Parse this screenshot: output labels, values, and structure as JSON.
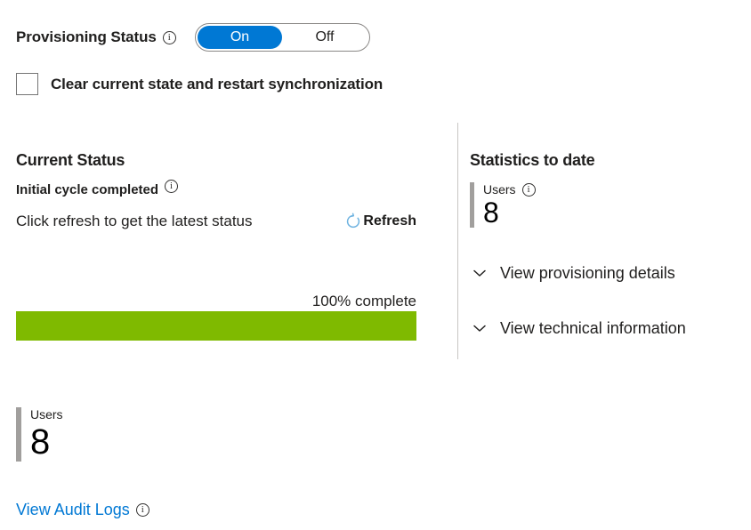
{
  "provisioning": {
    "label": "Provisioning Status",
    "info_icon": "info-icon",
    "toggle": {
      "on_label": "On",
      "off_label": "Off",
      "selected": "On"
    }
  },
  "clear_state": {
    "label": "Clear current state and restart synchronization",
    "checked": false
  },
  "current_status": {
    "title": "Current Status",
    "cycle_text": "Initial cycle completed",
    "cycle_info_icon": "info-icon",
    "hint": "Click refresh to get the latest status",
    "refresh_label": "Refresh",
    "refresh_icon": "refresh-icon",
    "progress": {
      "caption": "100% complete",
      "percent": 100
    }
  },
  "statistics": {
    "title": "Statistics to date",
    "stat": {
      "label": "Users",
      "value": "8",
      "info_icon": "info-icon"
    },
    "expanders": [
      {
        "label": "View provisioning details",
        "icon": "chevron-down-icon"
      },
      {
        "label": "View technical information",
        "icon": "chevron-down-icon"
      }
    ]
  },
  "bottom_stat": {
    "label": "Users",
    "value": "8"
  },
  "audit": {
    "link_label": "View Audit Logs",
    "info_icon": "info-icon"
  },
  "colors": {
    "accent_blue": "#0078d4",
    "progress_green": "#7fba00",
    "stat_bar_gray": "#a19f9d",
    "divider_gray": "#c8c6c4",
    "text_dark": "#201f1e"
  }
}
